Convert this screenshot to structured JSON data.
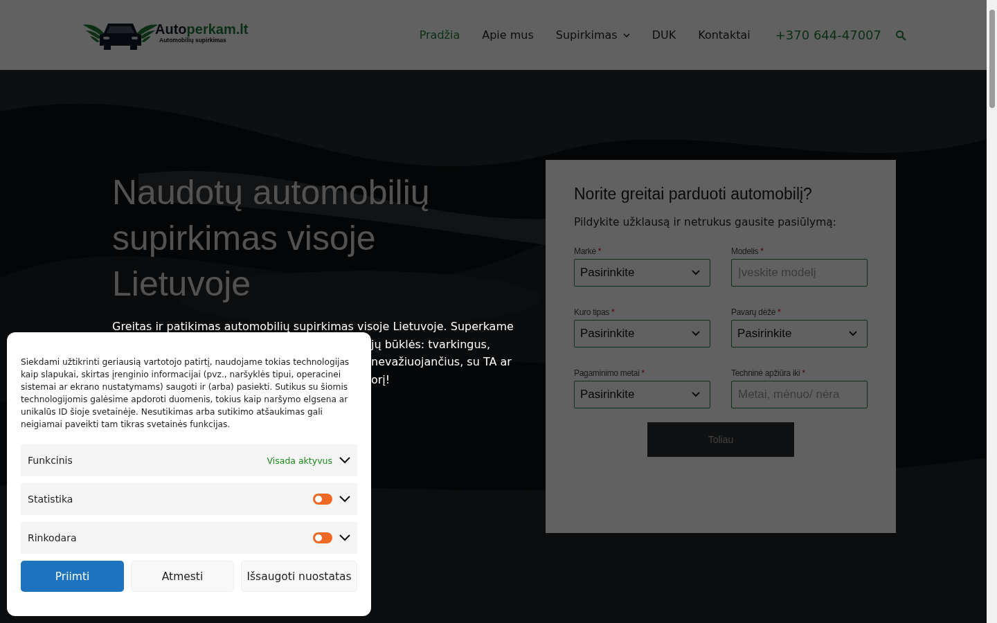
{
  "header": {
    "logo": {
      "name_parts": [
        "Auto",
        "perkam.lt"
      ],
      "tagline": "Automobilių supirkimas"
    },
    "nav": [
      {
        "label": "Pradžia",
        "selected": true,
        "has_submenu": false
      },
      {
        "label": "Apie mus",
        "selected": false,
        "has_submenu": false
      },
      {
        "label": "Supirkimas",
        "selected": false,
        "has_submenu": true
      },
      {
        "label": "DUK",
        "selected": false,
        "has_submenu": false
      },
      {
        "label": "Kontaktai",
        "selected": false,
        "has_submenu": false
      }
    ],
    "phone": "+370 644-47007"
  },
  "hero": {
    "title": "Naudotų automobilių supirkimas visoje Lietuvoje",
    "paragraph_lines": [
      "Greitas ir patikimas automobilių supirkimas visoje Lietuvoje. Superkame",
      "jų būklės: tvarkingus,",
      "nevažiuojančius, su TA ar",
      "orį!"
    ]
  },
  "form": {
    "title": "Norite greitai parduoti automobilį?",
    "subtitle": "Pildykite užklausą ir netrukus gausite pasiūlymą:",
    "fields": [
      {
        "kind": "select",
        "label": "Markė",
        "required": true,
        "value": "Pasirinkite"
      },
      {
        "kind": "input",
        "label": "Modelis",
        "required": true,
        "placeholder": "Įveskite modelį"
      },
      {
        "kind": "select",
        "label": "Kuro tipas",
        "required": true,
        "value": "Pasirinkite"
      },
      {
        "kind": "select",
        "label": "Pavarų dėžė",
        "required": true,
        "value": "Pasirinkite"
      },
      {
        "kind": "select",
        "label": "Pagaminimo metai",
        "required": true,
        "value": "Pasirinkite"
      },
      {
        "kind": "input",
        "label": "Techninė apžiūra iki",
        "required": true,
        "placeholder": "Metai, mėnuo/ nėra"
      }
    ],
    "submit": "Toliau",
    "required_mark": "*"
  },
  "cookie_banner": {
    "text": "Siekdami užtikrinti geriausią vartotojo patirtį, naudojame tokias technologijas kaip slapukai, skirtas įrenginio informacijai (pvz., naršyklės tipui, operacinei sistemai ar ekrano nustatymams) saugoti ir (arba) pasiekti. Sutikus su šiomis technologijomis galėsime apdoroti duomenis, tokius kaip naršymo elgsena ar unikalūs ID šioje svetainėje. Nesutikimas arba sutikimo atšaukimas gali neigiamai paveikti tam tikras svetainės funkcijas.",
    "categories": [
      {
        "kind": "status",
        "label": "Funkcinis",
        "status": "Visada aktyvus",
        "expanded": false
      },
      {
        "kind": "toggle",
        "label": "Statistika",
        "on": false,
        "expanded": false
      },
      {
        "kind": "toggle",
        "label": "Rinkodara",
        "on": false,
        "expanded": false
      }
    ],
    "buttons": [
      {
        "label": "Priimti",
        "kind": "primary"
      },
      {
        "label": "Atmesti",
        "kind": "secondary"
      },
      {
        "label": "Išsaugoti nuostatas",
        "kind": "secondary"
      }
    ]
  }
}
